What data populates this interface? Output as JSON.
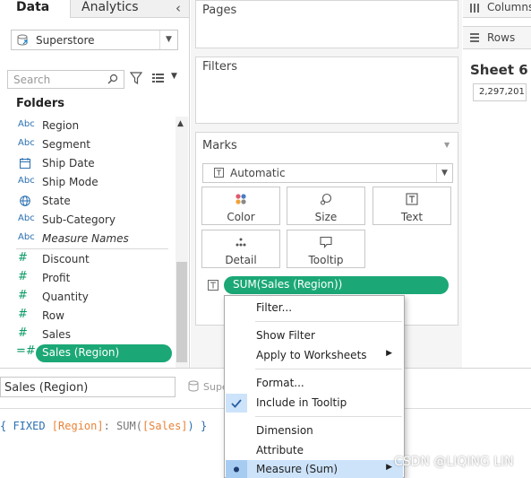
{
  "left_pane": {
    "tabs": {
      "data": "Data",
      "analytics": "Analytics",
      "collapse": "‹"
    },
    "datasource": {
      "label": "Superstore",
      "icon": "datasource-icon"
    },
    "search": {
      "placeholder": "Search"
    },
    "folders_title": "Folders",
    "fields": [
      {
        "type": "Abc",
        "label": "Region"
      },
      {
        "type": "Abc",
        "label": "Segment"
      },
      {
        "type": "date",
        "label": "Ship Date"
      },
      {
        "type": "Abc",
        "label": "Ship Mode"
      },
      {
        "type": "geo",
        "label": "State"
      },
      {
        "type": "Abc",
        "label": "Sub-Category"
      },
      {
        "type": "Abc",
        "label": "Measure Names"
      },
      {
        "type": "#",
        "label": "Discount"
      },
      {
        "type": "#",
        "label": "Profit"
      },
      {
        "type": "#",
        "label": "Quantity"
      },
      {
        "type": "#",
        "label": "Row"
      },
      {
        "type": "#",
        "label": "Sales"
      },
      {
        "type": "=#",
        "label": "Sales (Region)"
      }
    ]
  },
  "calc_editor": {
    "name": "Sales (Region)",
    "datasource_label": "Supe",
    "code": {
      "open": "{ FIXED ",
      "dim": "[Region]",
      "mid": ": SUM(",
      "meas": "[Sales]",
      "close": ") }"
    }
  },
  "shelves": {
    "pages": "Pages",
    "filters": "Filters",
    "marks": "Marks",
    "columns": "Columns",
    "rows": "Rows"
  },
  "marks": {
    "type": "Automatic",
    "buttons": {
      "color": "Color",
      "size": "Size",
      "text": "Text",
      "detail": "Detail",
      "tooltip": "Tooltip"
    },
    "pill": "SUM(Sales (Region))"
  },
  "sheet": {
    "title": "Sheet 6",
    "value": "2,297,201"
  },
  "context_menu": {
    "filter": "Filter...",
    "show_filter": "Show Filter",
    "apply_to_worksheets": "Apply to Worksheets",
    "format": "Format...",
    "include_in_tooltip": "Include in Tooltip",
    "dimension": "Dimension",
    "attribute": "Attribute",
    "measure": "Measure (Sum)"
  },
  "watermark": "CSDN @LIQING LIN",
  "colors": {
    "measure_green": "#1ba876",
    "dimension_blue": "#2a6fb0",
    "menu_highlight": "#cde3fa"
  }
}
